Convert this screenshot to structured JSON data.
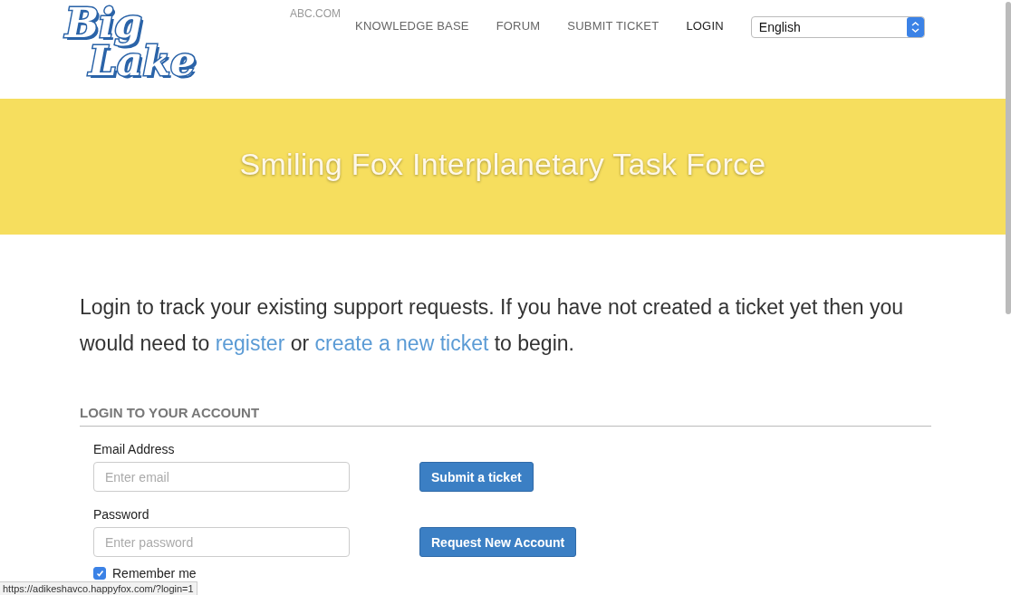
{
  "header": {
    "logo": [
      "Big",
      "Lake"
    ],
    "site_link": "ABC.COM",
    "nav": [
      {
        "label": "KNOWLEDGE BASE",
        "selected": false
      },
      {
        "label": "FORUM",
        "selected": false
      },
      {
        "label": "SUBMIT TICKET",
        "selected": false
      },
      {
        "label": "LOGIN",
        "selected": true
      }
    ],
    "language": {
      "value": "English"
    }
  },
  "banner": {
    "title": "Smiling Fox Interplanetary Task Force"
  },
  "intro": [
    {
      "kind": "text",
      "text": "Login to track your existing support requests. If you have not created a ticket yet then you would need to "
    },
    {
      "kind": "link",
      "text": "register"
    },
    {
      "kind": "text",
      "text": " or "
    },
    {
      "kind": "link",
      "text": "create a new ticket"
    },
    {
      "kind": "text",
      "text": " to begin."
    }
  ],
  "login": {
    "heading": "LOGIN TO YOUR ACCOUNT",
    "fields": [
      {
        "label": "Email Address",
        "placeholder": "Enter email"
      },
      {
        "label": "Password",
        "placeholder": "Enter password"
      }
    ],
    "buttons": [
      "Submit a ticket",
      "Request New Account"
    ],
    "remember": {
      "label": "Remember me",
      "checked": true
    }
  },
  "status_bar": {
    "url": "https://adikeshavco.happyfox.com/?login=1"
  }
}
